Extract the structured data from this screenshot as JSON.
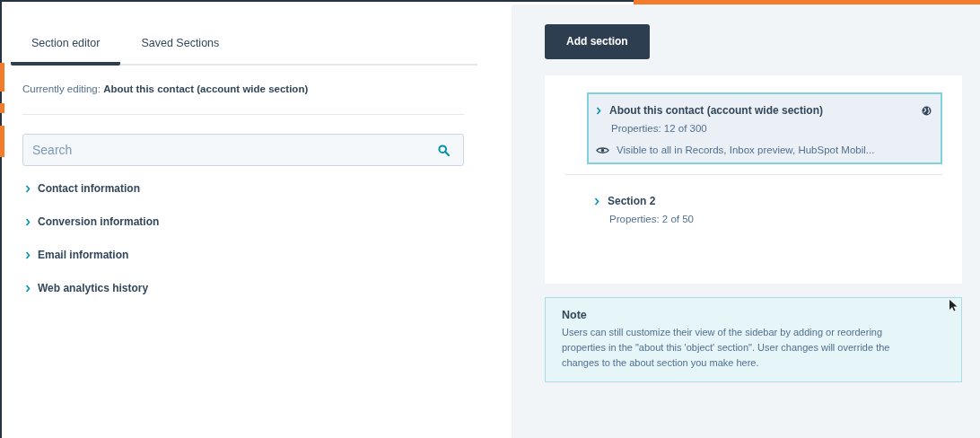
{
  "tabs": [
    {
      "label": "Section editor",
      "selected": true
    },
    {
      "label": "Saved Sections",
      "selected": false
    }
  ],
  "editing": {
    "label": "Currently editing:",
    "value": "About this contact (account wide section)"
  },
  "search": {
    "placeholder": "Search"
  },
  "property_groups": [
    {
      "label": "Contact information",
      "expanded": false
    },
    {
      "label": "Conversion information",
      "expanded": false
    },
    {
      "label": "Email information",
      "expanded": false
    },
    {
      "label": "Web analytics history",
      "expanded": false
    }
  ],
  "add_button": "Add section",
  "sections": [
    {
      "title": "About this contact (account wide section)",
      "properties": "Properties: 12 of 300",
      "visibility": "Visible to all in Records, Inbox preview, HubSpot Mobil...",
      "selected": true,
      "account_wide": true
    },
    {
      "title": "Section 2",
      "properties": "Properties: 2 of 50",
      "selected": false,
      "account_wide": false
    }
  ],
  "note": {
    "title": "Note",
    "text": "Users can still customize their view of the sidebar by adding or reordering properties in the \"about this 'object' section\". User changes will override the changes to the about section you make here."
  }
}
